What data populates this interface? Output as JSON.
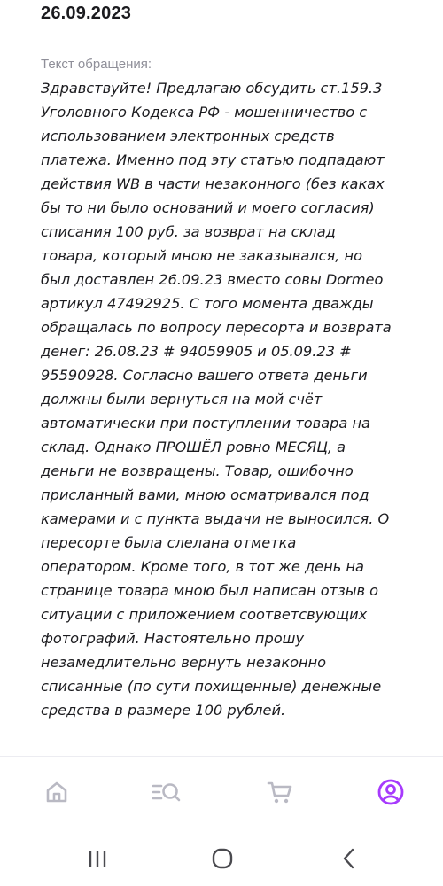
{
  "request": {
    "date": "26.09.2023",
    "label": "Текст обращения:",
    "text": "Здравствуйте! Предлагаю обсудить ст.159.3\nУголовного Кодекса РФ - мошенничество с\nиспользованием электронных средств\nплатежа. Именно под эту статью подпадают\nдействия WB в части незаконного (без каках\nбы то ни было оснований и моего согласия)\nсписания 100 руб. за возврат на склад\nтовара, который мною не заказывался, но\nбыл доставлен 26.09.23 вместо совы Dormeo\nартикул 47492925. С того момента дважды\nобращалась по вопросу пересорта и возврата\nденег: 26.08.23 # 94059905 и 05.09.23 #\n95590928. Согласно вашего ответа деньги\nдолжны были вернуться на мой счёт\nавтоматически при поступлении товара на\nсклад. Однако ПРОШЁЛ ровно МЕСЯЦ, а\nденьги не возвращены. Товар, ошибочно\nприсланный вами, мною осматривался под\nкамерами и с пункта выдачи не выносился. О\nпересорте была слелана отметка\nоператором. Кроме того, в тот же день на\nстранице товара мною был написан отзыв о\nситуации с приложением соответсвующих\nфотографий. Настоятельно прошу\nнезамедлительно вернуть незаконно\nсписанные (по сути похищенные) денежные\nсредства в размере 100 рублей."
  },
  "bottom_nav": {
    "items": [
      {
        "icon": "home-icon",
        "active": false
      },
      {
        "icon": "catalog-search-icon",
        "active": false
      },
      {
        "icon": "cart-icon",
        "active": false
      },
      {
        "icon": "profile-icon",
        "active": true
      }
    ]
  },
  "system_nav": {
    "items": [
      {
        "icon": "recent-apps-icon"
      },
      {
        "icon": "home-circle-icon"
      },
      {
        "icon": "back-icon"
      }
    ]
  },
  "colors": {
    "accent": "#a73afd",
    "inactive_icon": "#b9b9c3",
    "text": "#1b1b1f",
    "muted_text": "#8f8f99",
    "system_icon": "#4a4a4f"
  }
}
